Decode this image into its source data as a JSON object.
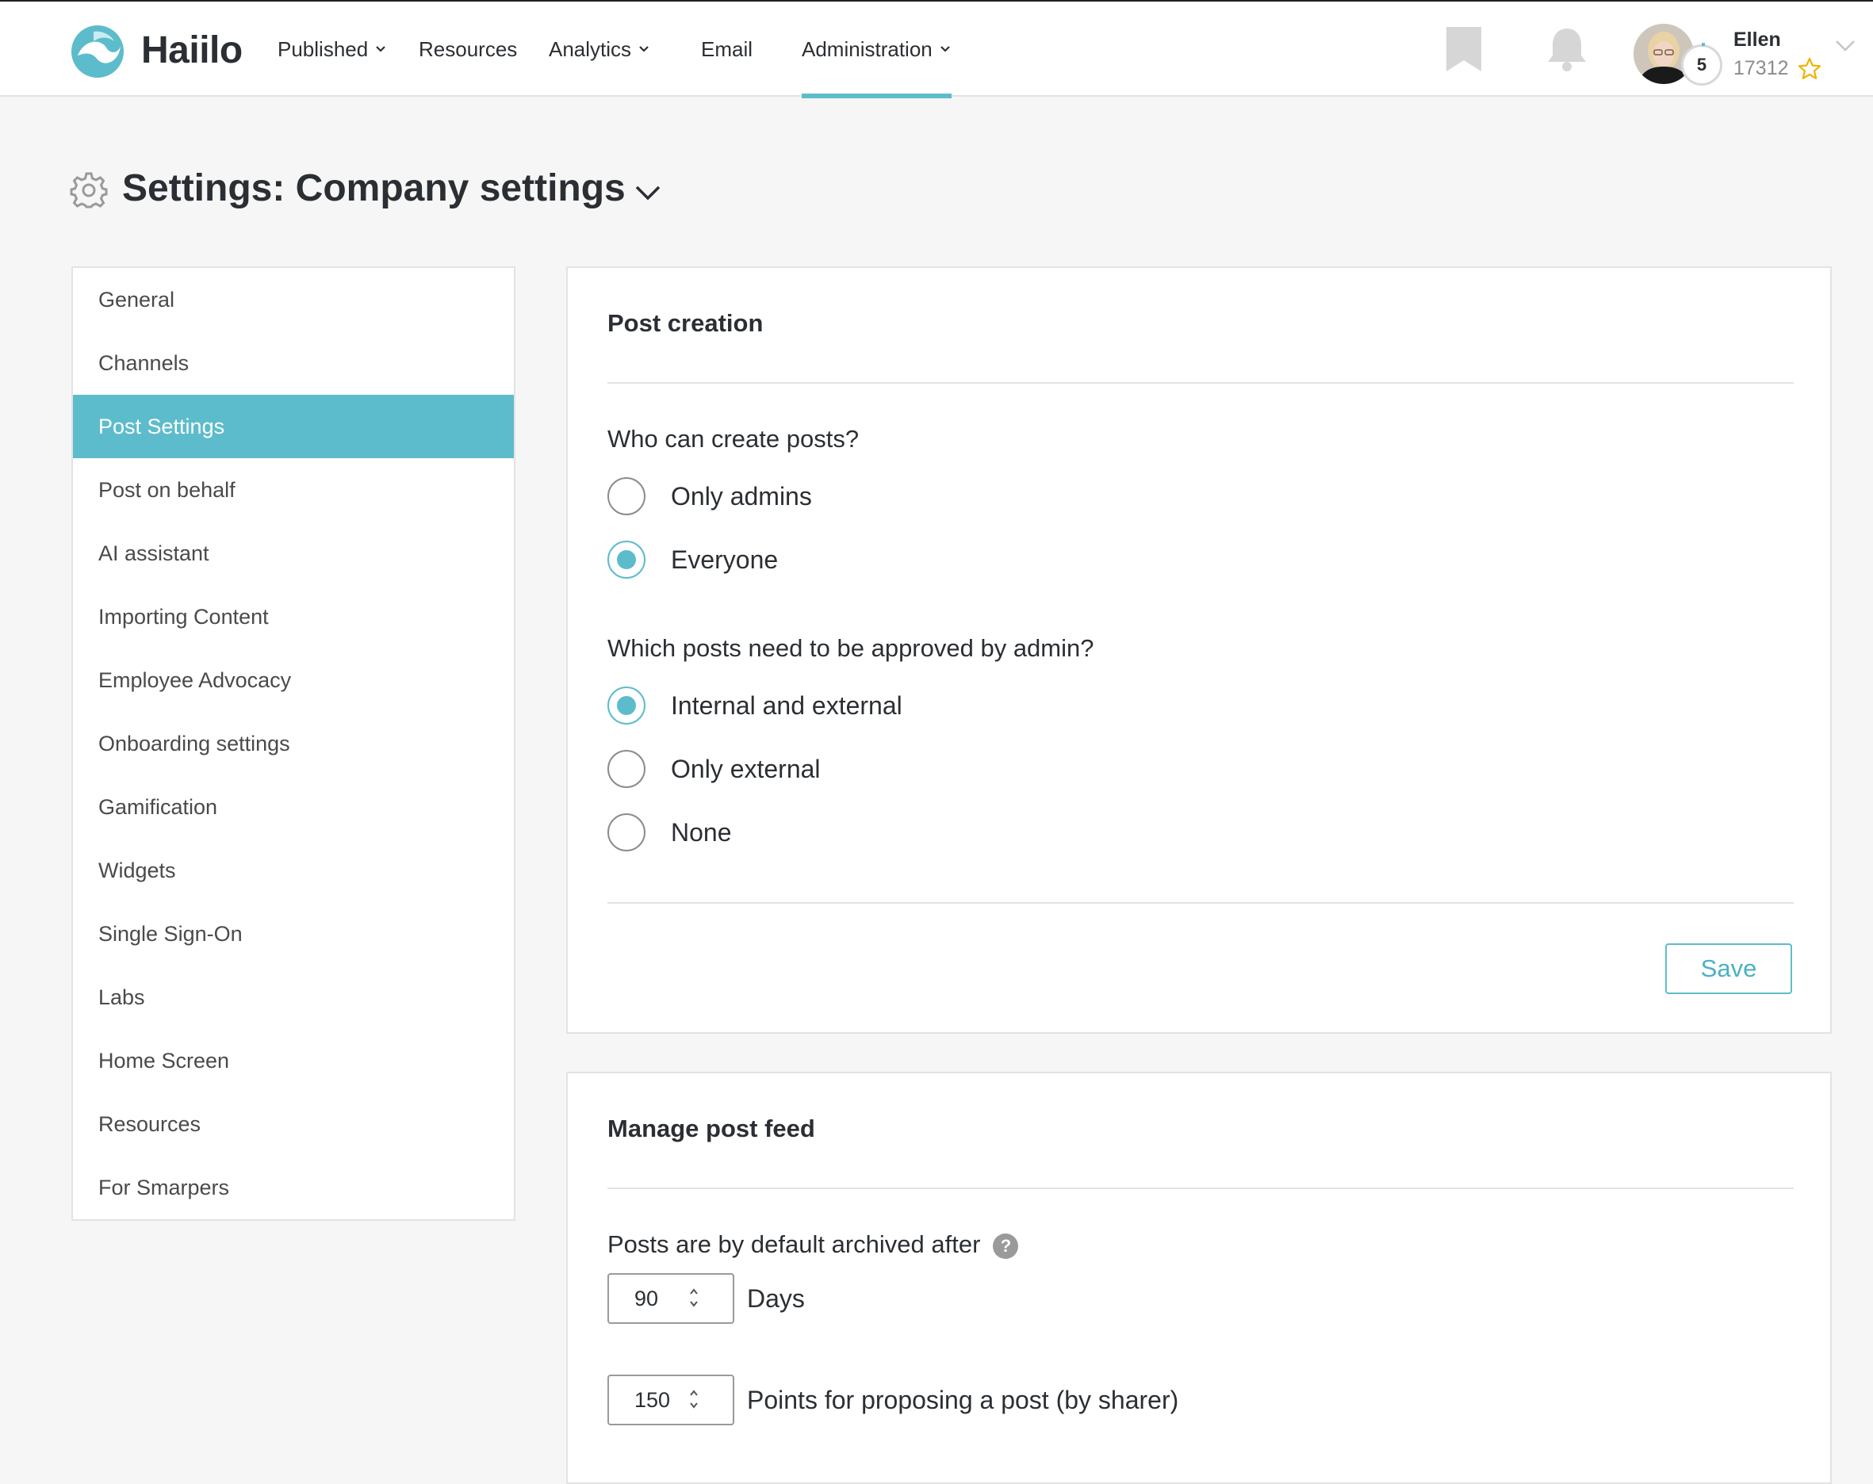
{
  "brand": {
    "name": "Haiilo",
    "accent": "#5dbccb"
  },
  "nav": {
    "items": [
      {
        "label": "Published",
        "has_dropdown": true
      },
      {
        "label": "Resources",
        "has_dropdown": false
      },
      {
        "label": "Analytics",
        "has_dropdown": true
      },
      {
        "label": "Email",
        "has_dropdown": false
      },
      {
        "label": "Administration",
        "has_dropdown": true,
        "active": true
      }
    ]
  },
  "user": {
    "name": "Ellen",
    "points": "17312",
    "level": "5"
  },
  "page": {
    "title": "Settings: Company settings"
  },
  "sidebar": {
    "items": [
      {
        "label": "General"
      },
      {
        "label": "Channels"
      },
      {
        "label": "Post Settings",
        "active": true
      },
      {
        "label": "Post on behalf"
      },
      {
        "label": "AI assistant"
      },
      {
        "label": "Importing Content"
      },
      {
        "label": "Employee Advocacy"
      },
      {
        "label": "Onboarding settings"
      },
      {
        "label": "Gamification"
      },
      {
        "label": "Widgets"
      },
      {
        "label": "Single Sign-On"
      },
      {
        "label": "Labs"
      },
      {
        "label": "Home Screen"
      },
      {
        "label": "Resources"
      },
      {
        "label": "For Smarpers"
      }
    ]
  },
  "post_creation": {
    "title": "Post creation",
    "who_can_create": {
      "question": "Who can create posts?",
      "options": [
        {
          "label": "Only admins",
          "checked": false
        },
        {
          "label": "Everyone",
          "checked": true
        }
      ]
    },
    "approval": {
      "question": "Which posts need to be approved by admin?",
      "options": [
        {
          "label": "Internal and external",
          "checked": true
        },
        {
          "label": "Only external",
          "checked": false
        },
        {
          "label": "None",
          "checked": false
        }
      ]
    },
    "save_label": "Save"
  },
  "post_feed": {
    "title": "Manage post feed",
    "archive_label": "Posts are by default archived after",
    "help": "?",
    "archive_days": "90",
    "archive_unit": "Days",
    "proposing_points": "150",
    "proposing_label": "Points for proposing a post (by sharer)"
  }
}
